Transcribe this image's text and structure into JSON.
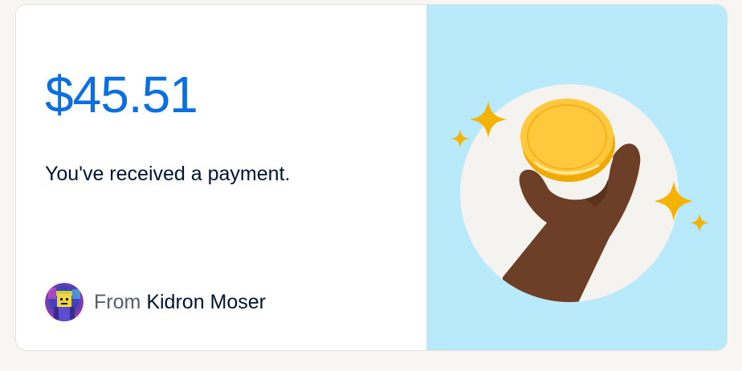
{
  "payment": {
    "amount": "$45.51",
    "message": "You've received a payment.",
    "from_label": "From",
    "sender_name": "Kidron Moser"
  },
  "colors": {
    "amount": "#0a6fe0",
    "text_primary": "#001435",
    "text_secondary": "#545d68",
    "illustration_background": "#b8eafb",
    "coin": "#ffc83d",
    "sparkle": "#f5b301",
    "hand": "#6e3f27"
  },
  "icons": {
    "avatar": "avatar-image",
    "illustration": "hand-holding-coin-illustration",
    "sparkles": "sparkle-icon"
  }
}
